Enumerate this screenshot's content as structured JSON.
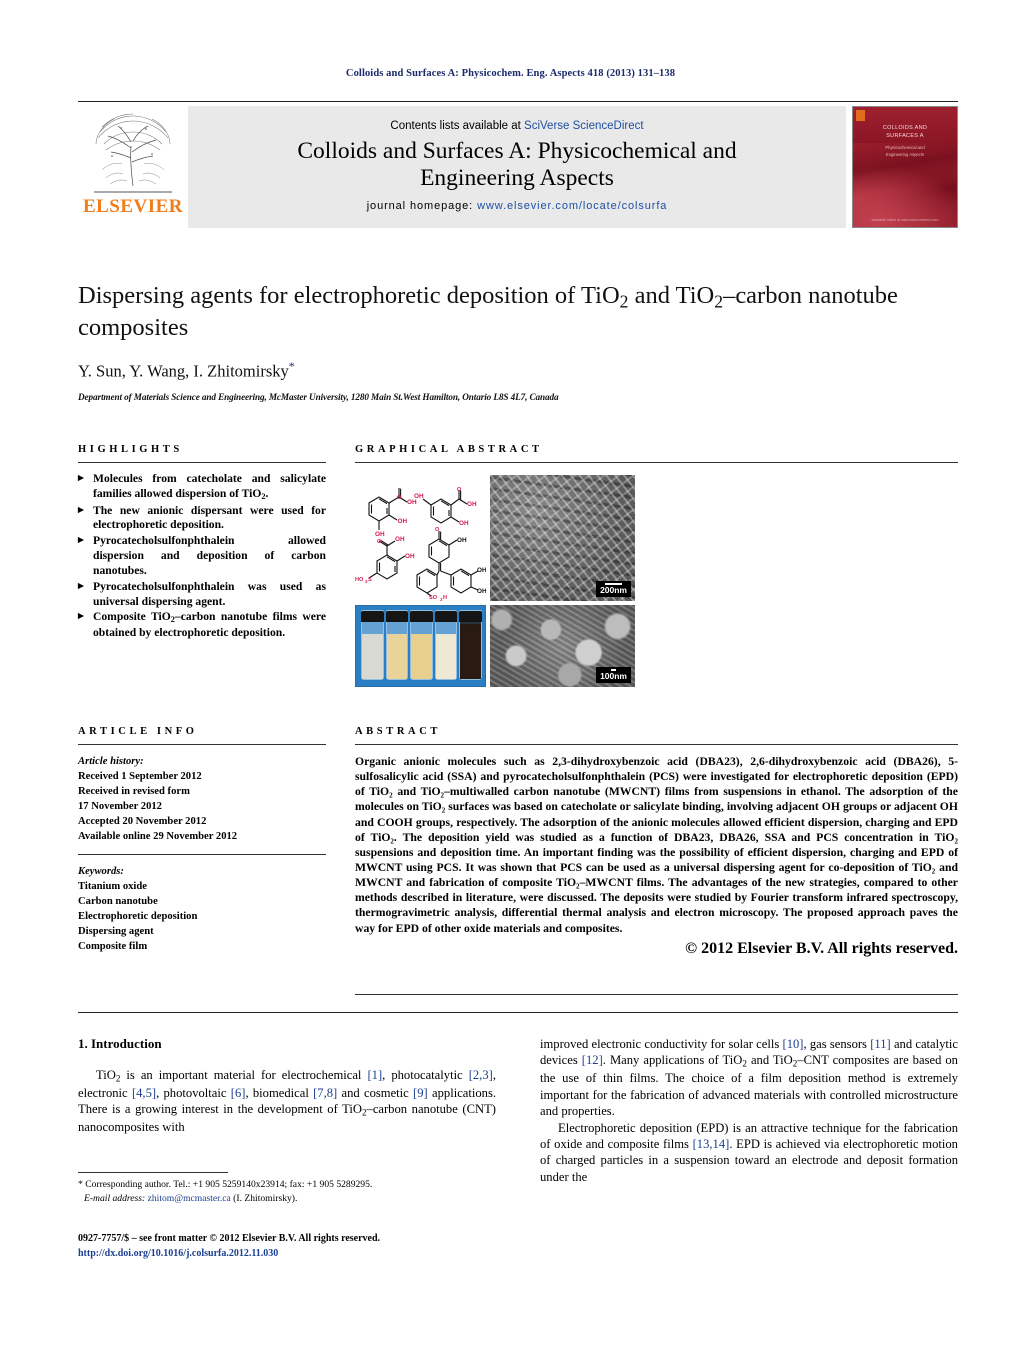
{
  "running_head": "Colloids and Surfaces A: Physicochem. Eng. Aspects 418 (2013) 131–138",
  "masthead": {
    "contents_prefix": "Contents lists available at ",
    "contents_link": "SciVerse ScienceDirect",
    "journal_title_line1": "Colloids and Surfaces A: Physicochemical and",
    "journal_title_line2": "Engineering Aspects",
    "homepage_label": "journal homepage: ",
    "homepage_url": "www.elsevier.com/locate/colsurfa",
    "publisher": "ELSEVIER",
    "cover": {
      "title_line1": "COLLOIDS AND",
      "title_line2": "SURFACES A",
      "sub_line1": "Physicochemical and",
      "sub_line2": "Engineering Aspects",
      "foot": "available online at www.sciencedirect.com"
    }
  },
  "article": {
    "title": "Dispersing agents for electrophoretic deposition of TiO₂ and TiO₂–carbon nanotube composites",
    "authors": "Y. Sun, Y. Wang, I. Zhitomirsky",
    "author_star": "*",
    "affiliation": "Department of Materials Science and Engineering, McMaster University, 1280 Main St.West Hamilton, Ontario L8S 4L7, Canada"
  },
  "highlights": {
    "heading": "HIGHLIGHTS",
    "items": [
      "Molecules from catecholate and salicylate families allowed dispersion of TiO₂.",
      "The new anionic dispersant were used for electrophoretic deposition.",
      "Pyrocatecholsulfonphthalein allowed dispersion and deposition of carbon nanotubes.",
      "Pyrocatecholsulfonphthalein was used as universal dispersing agent.",
      "Composite TiO₂–carbon nanotube films were obtained by electrophoretic deposition."
    ]
  },
  "graphical_abstract": {
    "heading": "GRAPHICAL ABSTRACT",
    "figure": {
      "chem_panel_name": "chemical-structures",
      "vials_panel_name": "suspension-vials-photo",
      "sem_top_scalebar": "200nm",
      "sem_bottom_scalebar": "100nm",
      "vial_colors": [
        "#d9d9d4",
        "#e8d49a",
        "#e8cf8e",
        "#efe8d2",
        "#2a1a12"
      ]
    }
  },
  "article_info": {
    "heading": "ARTICLE INFO",
    "history_label": "Article history:",
    "history": [
      "Received 1 September 2012",
      "Received in revised form",
      "17 November 2012",
      "Accepted 20 November 2012",
      "Available online 29 November 2012"
    ],
    "keywords_label": "Keywords:",
    "keywords": [
      "Titanium oxide",
      "Carbon nanotube",
      "Electrophoretic deposition",
      "Dispersing agent",
      "Composite film"
    ]
  },
  "abstract": {
    "heading": "ABSTRACT",
    "text": "Organic anionic molecules such as 2,3-dihydroxybenzoic acid (DBA23), 2,6-dihydroxybenzoic acid (DBA26), 5-sulfosalicylic acid (SSA) and pyrocatecholsulfonphthalein (PCS) were investigated for electrophoretic deposition (EPD) of TiO₂ and TiO₂–multiwalled carbon nanotube (MWCNT) films from suspensions in ethanol. The adsorption of the molecules on TiO₂ surfaces was based on catecholate or salicylate binding, involving adjacent OH groups or adjacent OH and COOH groups, respectively. The adsorption of the anionic molecules allowed efficient dispersion, charging and EPD of TiO₂. The deposition yield was studied as a function of DBA23, DBA26, SSA and PCS concentration in TiO₂ suspensions and deposition time. An important finding was the possibility of efficient dispersion, charging and EPD of MWCNT using PCS. It was shown that PCS can be used as a universal dispersing agent for co-deposition of TiO₂ and MWCNT and fabrication of composite TiO₂–MWCNT films. The advantages of the new strategies, compared to other methods described in literature, were discussed. The deposits were studied by Fourier transform infrared spectroscopy, thermogravimetric analysis, differential thermal analysis and electron microscopy. The proposed approach paves the way for EPD of other oxide materials and composites.",
    "copyright": "© 2012 Elsevier B.V. All rights reserved."
  },
  "introduction": {
    "heading": "1.  Introduction",
    "left_paragraph": "TiO₂ is an important material for electrochemical [1], photocatalytic [2,3], electronic [4,5], photovoltaic [6], biomedical [7,8] and cosmetic [9] applications. There is a growing interest in the development of TiO₂–carbon nanotube (CNT) nanocomposites with",
    "right_paragraph_1": "improved electronic conductivity for solar cells [10], gas sensors [11] and catalytic devices [12]. Many applications of TiO₂ and TiO₂–CNT composites are based on the use of thin films. The choice of a film deposition method is extremely important for the fabrication of advanced materials with controlled microstructure and properties.",
    "right_paragraph_2": "Electrophoretic deposition (EPD) is an attractive technique for the fabrication of oxide and composite films [13,14]. EPD is achieved via electrophoretic motion of charged particles in a suspension toward an electrode and deposit formation under the"
  },
  "footnote": {
    "corresponding": "* Corresponding author. Tel.: +1 905 5259140x23914; fax: +1 905 5289295.",
    "email_label": "E-mail address: ",
    "email": "zhitom@mcmaster.ca",
    "email_suffix": " (I. Zhitomirsky)."
  },
  "page_footer": {
    "issn_line": "0927-7757/$ – see front matter © 2012 Elsevier B.V. All rights reserved.",
    "doi": "http://dx.doi.org/10.1016/j.colsurfa.2012.11.030"
  }
}
